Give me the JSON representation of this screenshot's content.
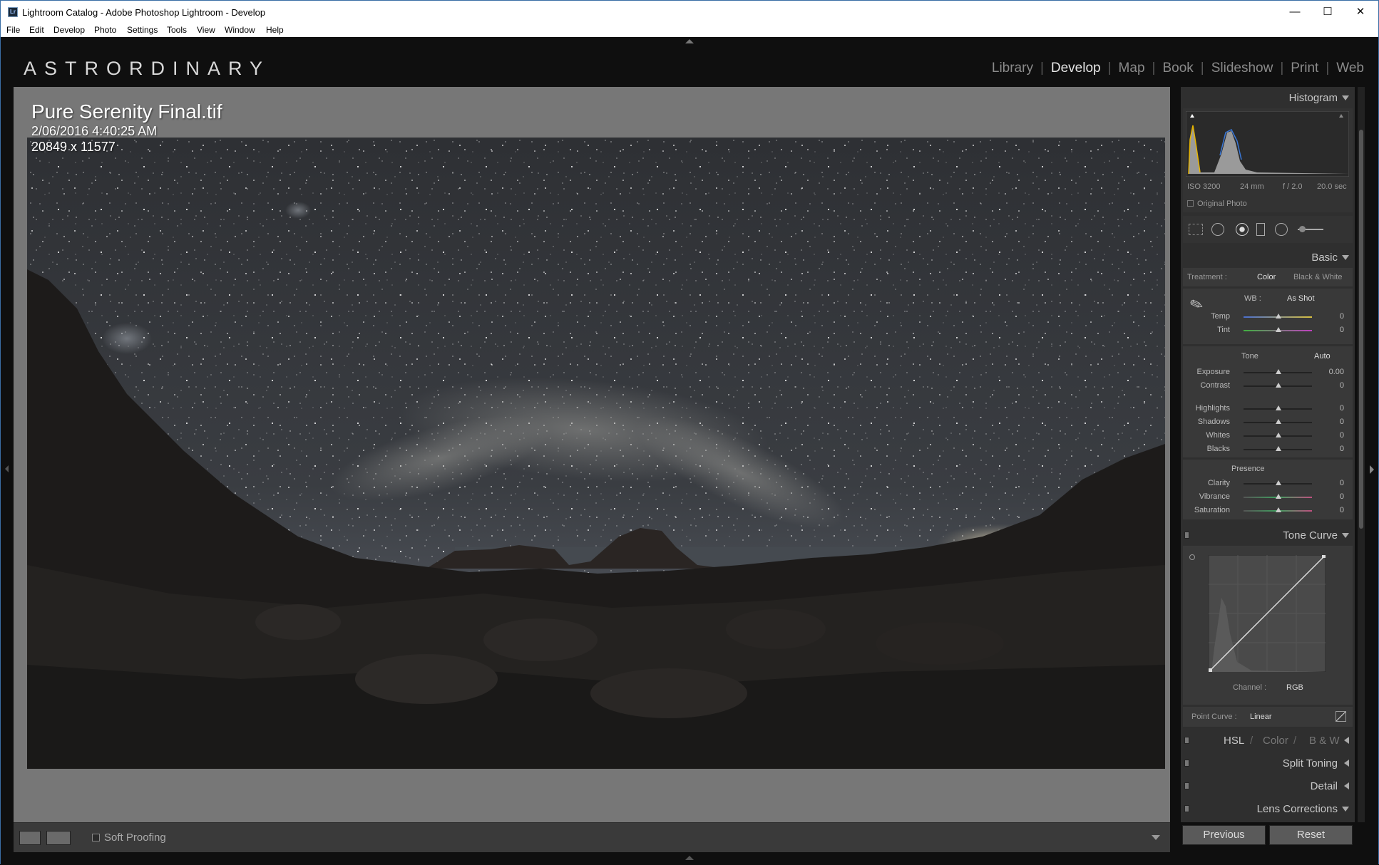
{
  "window": {
    "title": "Lightroom Catalog - Adobe Photoshop Lightroom - Develop",
    "app_icon": "Lr",
    "controls": [
      "—",
      "☐",
      "✕"
    ]
  },
  "menu": [
    "File",
    "Edit",
    "Develop",
    "Photo",
    "Settings",
    "Tools",
    "View",
    "Window",
    "Help"
  ],
  "identity_plate": "ASTRORDINARY",
  "modules": [
    "Library",
    "Develop",
    "Map",
    "Book",
    "Slideshow",
    "Print",
    "Web"
  ],
  "active_module": "Develop",
  "photo_info": {
    "filename": "Pure Serenity Final.tif",
    "datetime": "2/06/2016 4:40:25 AM",
    "dimensions": "20849 x 11577"
  },
  "toolbar": {
    "soft_proofing": "Soft Proofing"
  },
  "histogram": {
    "title": "Histogram",
    "iso": "ISO 3200",
    "focal": "24 mm",
    "aperture": "f / 2.0",
    "shutter": "20.0 sec",
    "original_photo": "Original Photo"
  },
  "basic": {
    "title": "Basic",
    "treatment_label": "Treatment :",
    "treatment_color": "Color",
    "treatment_bw": "Black & White",
    "wb_label": "WB :",
    "wb_value": "As Shot",
    "tone_label": "Tone",
    "auto": "Auto",
    "presence_label": "Presence",
    "wb_sliders": [
      {
        "label": "Temp",
        "value": "0"
      },
      {
        "label": "Tint",
        "value": "0"
      }
    ],
    "tone_sliders": [
      {
        "label": "Exposure",
        "value": "0.00"
      },
      {
        "label": "Contrast",
        "value": "0"
      }
    ],
    "tone_sliders2": [
      {
        "label": "Highlights",
        "value": "0"
      },
      {
        "label": "Shadows",
        "value": "0"
      },
      {
        "label": "Whites",
        "value": "0"
      },
      {
        "label": "Blacks",
        "value": "0"
      }
    ],
    "presence_sliders": [
      {
        "label": "Clarity",
        "value": "0"
      },
      {
        "label": "Vibrance",
        "value": "0"
      },
      {
        "label": "Saturation",
        "value": "0"
      }
    ]
  },
  "tone_curve": {
    "title": "Tone Curve",
    "channel_label": "Channel :",
    "channel_value": "RGB",
    "point_curve_label": "Point Curve :",
    "point_curve_value": "Linear"
  },
  "hsl": {
    "hsl": "HSL",
    "color": "Color",
    "bw": "B & W"
  },
  "panels": {
    "split_toning": "Split Toning",
    "detail": "Detail",
    "lens_corrections": "Lens Corrections"
  },
  "buttons": {
    "previous": "Previous",
    "reset": "Reset"
  }
}
